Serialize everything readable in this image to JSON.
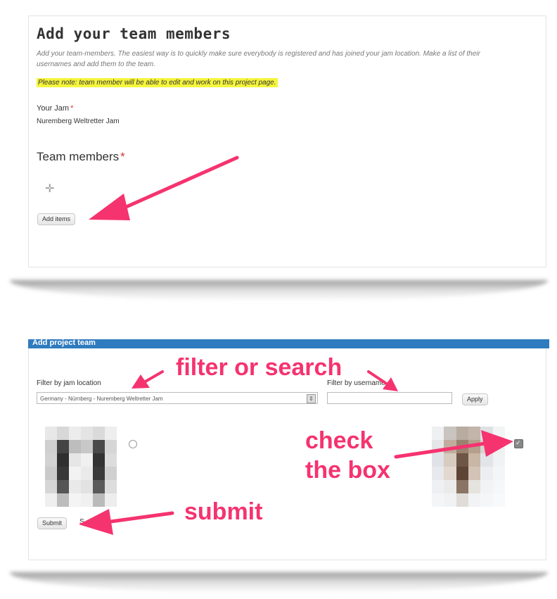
{
  "panel1": {
    "heading": "Add your team members",
    "description": "Add your team-members. The easiest way is to quickly make sure everybody is registered and has joined your jam location. Make a list of their usernames and add them to the team.",
    "note": "Please note: team member will be able to edit and work on this project page.",
    "jam_label": "Your Jam",
    "required_marker": "*",
    "jam_value": "Nuremberg Weltretter Jam",
    "team_members_label": "Team members",
    "add_items_button": "Add items"
  },
  "panel2": {
    "title": "Add project team",
    "filter_location_label": "Filter by jam location",
    "filter_location_value": "Germany - Nürnberg - Nuremberg Weltretter Jam",
    "filter_username_label": "Filter by username",
    "apply_button": "Apply",
    "submit_button": "Submit",
    "trailing_char": "S"
  },
  "annotations": {
    "filter_or_search": "filter or search",
    "check_the_box_line1": "check",
    "check_the_box_line2": "the box",
    "submit": "submit",
    "color": "#f5336f"
  }
}
